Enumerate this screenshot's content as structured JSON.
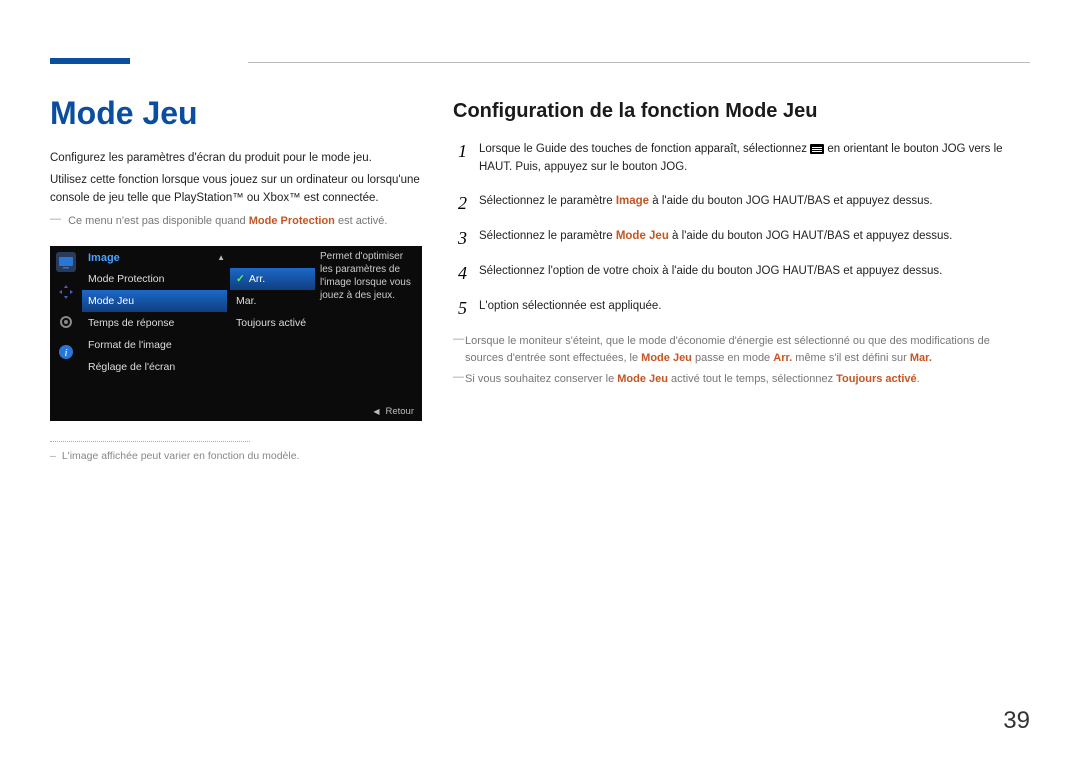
{
  "page_number": "39",
  "left": {
    "title": "Mode Jeu",
    "p1": "Configurez les paramètres d'écran du produit pour le mode jeu.",
    "p2": "Utilisez cette fonction lorsque vous jouez sur un ordinateur ou lorsqu'une console de jeu telle que PlayStation™ ou Xbox™ est connectée.",
    "note1_pre": "Ce menu n'est pas disponible quand ",
    "note1_hl": "Mode Protection",
    "note1_post": " est activé.",
    "footnote": "L'image affichée peut varier en fonction du modèle."
  },
  "osd": {
    "header": "Image",
    "items": [
      "Mode Protection",
      "Mode Jeu",
      "Temps de réponse",
      "Format de l'image",
      "Réglage de l'écran"
    ],
    "selected_index": 1,
    "options": [
      "Arr.",
      "Mar.",
      "Toujours activé"
    ],
    "option_selected_index": 0,
    "description": "Permet d'optimiser les paramètres de l'image lorsque vous jouez à des jeux.",
    "return_label": "Retour"
  },
  "right": {
    "title": "Configuration de la fonction Mode Jeu",
    "steps": {
      "s1_pre": "Lorsque le Guide des touches de fonction apparaît, sélectionnez ",
      "s1_post": " en orientant le bouton JOG vers le HAUT. Puis, appuyez sur le bouton JOG.",
      "s2_pre": "Sélectionnez le paramètre ",
      "s2_hl": "Image",
      "s2_post": " à l'aide du bouton JOG HAUT/BAS et appuyez dessus.",
      "s3_pre": "Sélectionnez le paramètre ",
      "s3_hl": "Mode Jeu",
      "s3_post": " à l'aide du bouton JOG HAUT/BAS et appuyez dessus.",
      "s4": "Sélectionnez l'option de votre choix à l'aide du bouton JOG HAUT/BAS et appuyez dessus.",
      "s5": "L'option sélectionnée est appliquée."
    },
    "note2_pre": "Lorsque le moniteur s'éteint, que le mode d'économie d'énergie est sélectionné ou que des modifications de sources d'entrée sont effectuées, le ",
    "note2_hl1": "Mode Jeu",
    "note2_mid": " passe en mode ",
    "note2_hl2": "Arr.",
    "note2_mid2": " même s'il est défini sur ",
    "note2_hl3": "Mar.",
    "note3_pre": "Si vous souhaitez conserver le ",
    "note3_hl1": "Mode Jeu",
    "note3_mid": " activé tout le temps, sélectionnez ",
    "note3_hl2": "Toujours activé",
    "note3_post": "."
  }
}
